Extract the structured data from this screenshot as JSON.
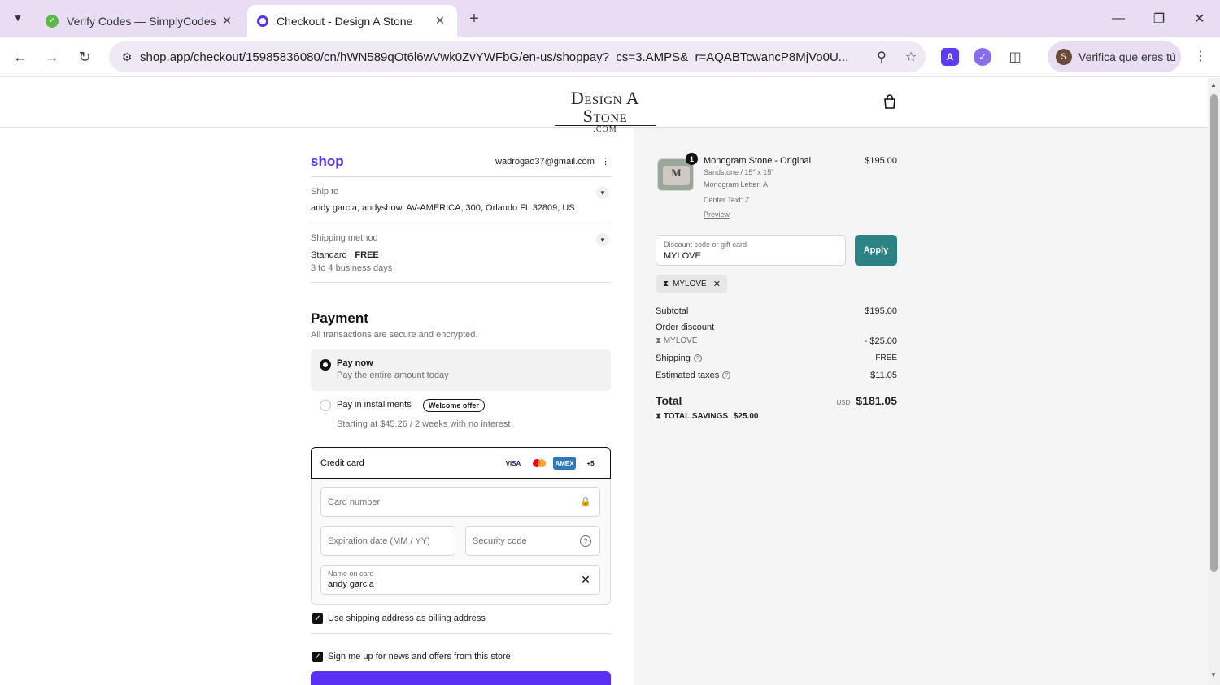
{
  "browser": {
    "tabs": [
      {
        "title": "Verify Codes — SimplyCodes",
        "active": false
      },
      {
        "title": "Checkout - Design A Stone",
        "active": true
      }
    ],
    "url": "shop.app/checkout/15985836080/cn/hWN589qOt6l6wVwk0ZvYWFbG/en-us/shoppay?_cs=3.AMPS&_r=AQABTcwancP8MjVo0U...",
    "profile_label": "Verifica que eres tú",
    "profile_initial": "S",
    "ext_a": "A"
  },
  "header": {
    "logo_main": "Design A Stone",
    "logo_sub": ".COM"
  },
  "account": {
    "shop_logo": "shop",
    "email": "wadrogao37@gmail.com"
  },
  "ship_to": {
    "label": "Ship to",
    "address": "andy garcia, andyshow, AV-AMERICA, 300, Orlando FL 32809, US"
  },
  "shipping_method": {
    "label": "Shipping method",
    "method": "Standard · ",
    "price": "FREE",
    "eta": "3 to 4 business days"
  },
  "payment": {
    "title": "Payment",
    "subtitle": "All transactions are secure and encrypted.",
    "option_pay_now": {
      "label": "Pay now",
      "desc": "Pay the entire amount today"
    },
    "option_installments": {
      "label": "Pay in installments",
      "badge": "Welcome offer",
      "desc": "Starting at $45.26 / 2 weeks with no interest"
    },
    "credit_card": {
      "label": "Credit card",
      "brands": [
        "VISA",
        "",
        "AMEX",
        "+5"
      ],
      "card_number_placeholder": "Card number",
      "expiry_placeholder": "Expiration date (MM / YY)",
      "security_placeholder": "Security code",
      "name_label": "Name on card",
      "name_value": "andy garcia"
    },
    "billing_same": "Use shipping address as billing address",
    "newsletter": "Sign me up for news and offers from this store"
  },
  "order": {
    "item": {
      "quantity": "1",
      "name": "Monogram Stone - Original",
      "price": "$195.00",
      "variant": "Sandstone / 15\" x 15\"",
      "monogram": "Monogram Letter: A",
      "center_text": "Center Text: Z",
      "preview_link": "Preview"
    },
    "discount": {
      "label": "Discount code or gift card",
      "value": "MYLOVE",
      "apply": "Apply",
      "chip": "MYLOVE"
    },
    "subtotal_label": "Subtotal",
    "subtotal": "$195.00",
    "order_discount_label": "Order discount",
    "discount_code": "MYLOVE",
    "discount_amount": "- $25.00",
    "shipping_label": "Shipping",
    "shipping_value": "FREE",
    "taxes_label": "Estimated taxes",
    "taxes_value": "$11.05",
    "total_label": "Total",
    "currency": "USD",
    "total": "$181.05",
    "savings_label": "TOTAL SAVINGS",
    "savings": "$25.00"
  },
  "colors": {
    "shop_purple": "#5a31f4",
    "apply_teal": "#2c8383",
    "chrome_lavender": "#e9ddf3"
  }
}
